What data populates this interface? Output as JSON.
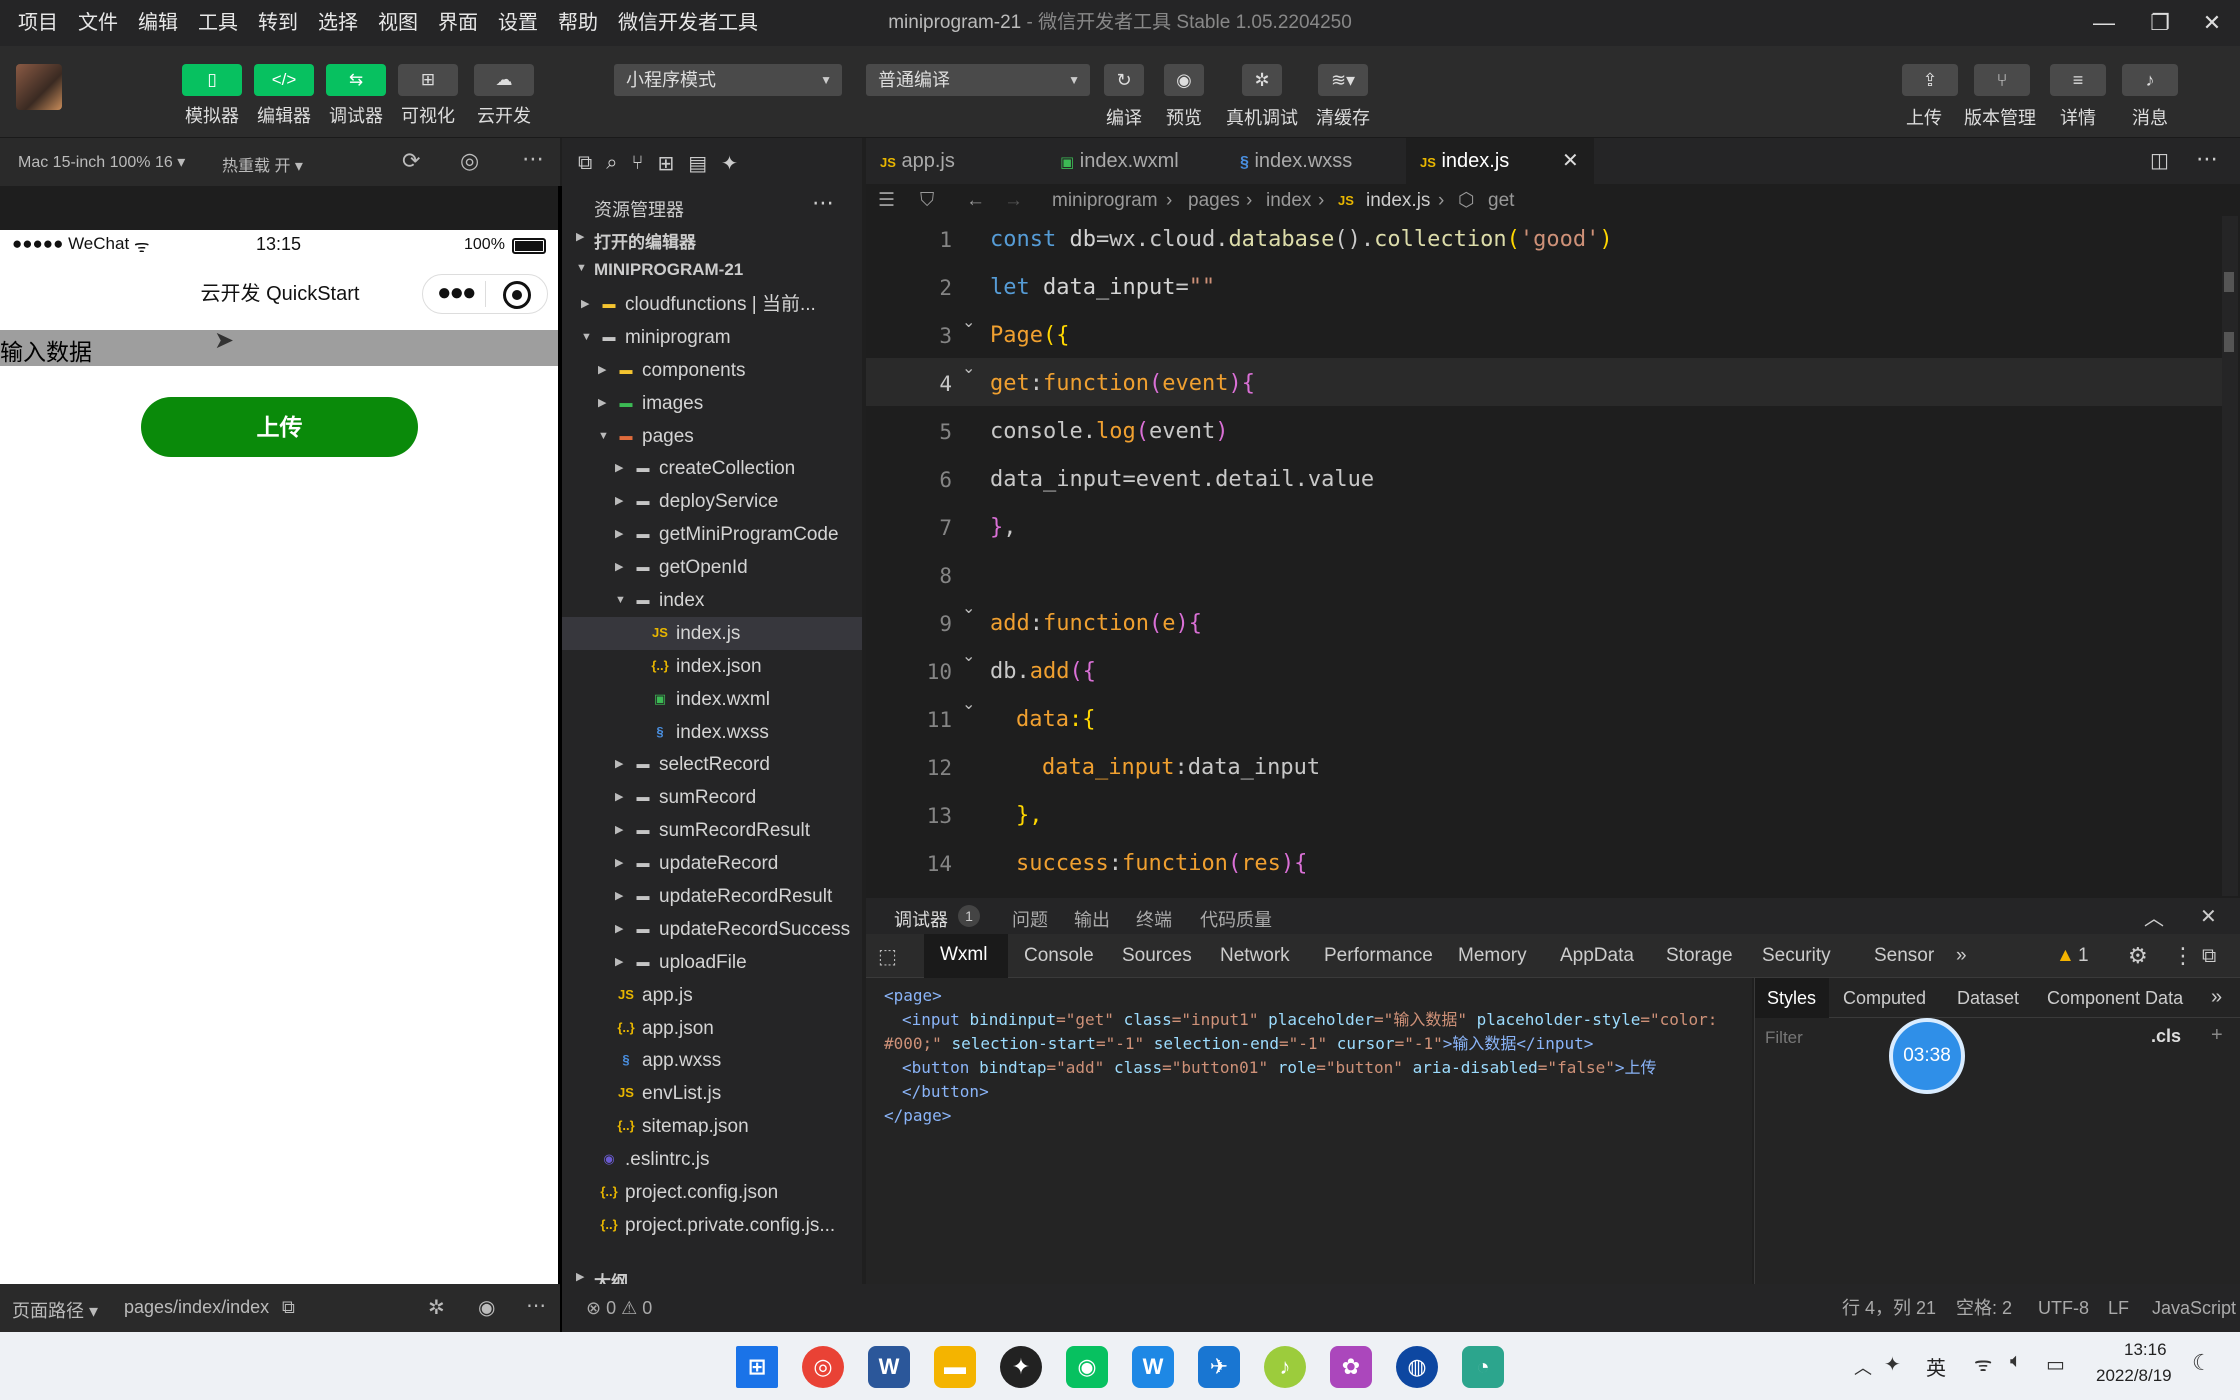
{
  "menu": [
    "项目",
    "文件",
    "编辑",
    "工具",
    "转到",
    "选择",
    "视图",
    "界面",
    "设置",
    "帮助",
    "微信开发者工具"
  ],
  "window": {
    "title": "miniprogram-21",
    "subtitle": " - 微信开发者工具 Stable 1.05.2204250"
  },
  "toolbar": {
    "buttons": [
      {
        "label": "模拟器"
      },
      {
        "label": "编辑器"
      },
      {
        "label": "调试器"
      },
      {
        "label": "可视化"
      },
      {
        "label": "云开发"
      }
    ],
    "mode_select": "小程序模式",
    "compile_select": "普通编译",
    "actions": [
      "编译",
      "预览",
      "真机调试",
      "清缓存"
    ],
    "right": [
      "上传",
      "版本管理",
      "详情",
      "消息"
    ]
  },
  "simulator": {
    "device": "Mac 15-inch 100% 16 ▾",
    "hotreload": "热重载 开 ▾",
    "status_carrier": "●●●●● WeChat",
    "status_time": "13:15",
    "status_battery": "100%",
    "nav_title": "云开发 QuickStart",
    "input_placeholder": "输入数据",
    "upload_button": "上传",
    "path_label": "页面路径 ▾",
    "path_value": "pages/index/index"
  },
  "explorer": {
    "title": "资源管理器",
    "open_editors": "打开的编辑器",
    "project": "MINIPROGRAM-21",
    "outline": "大纲",
    "items": [
      {
        "name": "cloudfunctions | 当前...",
        "type": "folder-cloud"
      },
      {
        "name": "miniprogram",
        "type": "folder-open"
      },
      {
        "name": "components",
        "type": "folder-comp"
      },
      {
        "name": "images",
        "type": "folder-img"
      },
      {
        "name": "pages",
        "type": "folder-pages"
      },
      {
        "name": "createCollection",
        "type": "folder"
      },
      {
        "name": "deployService",
        "type": "folder"
      },
      {
        "name": "getMiniProgramCode",
        "type": "folder"
      },
      {
        "name": "getOpenId",
        "type": "folder"
      },
      {
        "name": "index",
        "type": "folder-open"
      },
      {
        "name": "index.js",
        "type": "js"
      },
      {
        "name": "index.json",
        "type": "json"
      },
      {
        "name": "index.wxml",
        "type": "wxml"
      },
      {
        "name": "index.wxss",
        "type": "wxss"
      },
      {
        "name": "selectRecord",
        "type": "folder"
      },
      {
        "name": "sumRecord",
        "type": "folder"
      },
      {
        "name": "sumRecordResult",
        "type": "folder"
      },
      {
        "name": "updateRecord",
        "type": "folder"
      },
      {
        "name": "updateRecordResult",
        "type": "folder"
      },
      {
        "name": "updateRecordSuccess",
        "type": "folder"
      },
      {
        "name": "uploadFile",
        "type": "folder"
      },
      {
        "name": "app.js",
        "type": "js"
      },
      {
        "name": "app.json",
        "type": "json"
      },
      {
        "name": "app.wxss",
        "type": "wxss"
      },
      {
        "name": "envList.js",
        "type": "js"
      },
      {
        "name": "sitemap.json",
        "type": "json"
      },
      {
        "name": ".eslintrc.js",
        "type": "eslint"
      },
      {
        "name": "project.config.json",
        "type": "json"
      },
      {
        "name": "project.private.config.js...",
        "type": "json"
      }
    ]
  },
  "tabs": [
    {
      "name": "app.js",
      "icon": "JS"
    },
    {
      "name": "index.wxml",
      "icon": "W"
    },
    {
      "name": "index.wxss",
      "icon": "§"
    },
    {
      "name": "index.js",
      "icon": "JS",
      "active": true
    }
  ],
  "breadcrumb": [
    "miniprogram",
    "pages",
    "index",
    "index.js",
    "get"
  ],
  "code": [
    {
      "n": "1"
    },
    {
      "n": "2"
    },
    {
      "n": "3"
    },
    {
      "n": "4"
    },
    {
      "n": "5"
    },
    {
      "n": "6"
    },
    {
      "n": "7"
    },
    {
      "n": "8"
    },
    {
      "n": "9"
    },
    {
      "n": "10"
    },
    {
      "n": "11"
    },
    {
      "n": "12"
    },
    {
      "n": "13"
    },
    {
      "n": "14"
    }
  ],
  "code_text": {
    "l1a": "const ",
    "l1b": "db",
    "l1c": "=wx.cloud.",
    "l1d": "database",
    "l1e": "().",
    "l1f": "collection",
    "l1g": "(",
    "l1h": "'good'",
    "l1i": ")",
    "l2a": "let ",
    "l2b": "data_input",
    "l2c": "=",
    "l2d": "\"\"",
    "l3a": "Page",
    "l3b": "({",
    "l4a": "get",
    "l4b": ":",
    "l4c": "function",
    "l4d": "(",
    "l4e": "event",
    "l4f": "){",
    "l5a": "console",
    "l5b": ".",
    "l5c": "log",
    "l5d": "(",
    "l5e": "event",
    "l5f": ")",
    "l6a": "data_input",
    "l6b": "=event.detail.value",
    "l7a": "}",
    "l7b": ",",
    "l9a": "add",
    "l9b": ":",
    "l9c": "function",
    "l9d": "(",
    "l9e": "e",
    "l9f": "){",
    "l10a": "db",
    "l10b": ".",
    "l10c": "add",
    "l10d": "({",
    "l11a": "data",
    "l11b": ":{",
    "l12a": "data_input",
    "l12b": ":data_input",
    "l13a": "},",
    "l14a": "success",
    "l14b": ":",
    "l14c": "function",
    "l14d": "(",
    "l14e": "res",
    "l14f": "){"
  },
  "debug": {
    "tabs": [
      "调试器",
      "问题",
      "输出",
      "终端",
      "代码质量"
    ],
    "badge": "1",
    "devtools": [
      "Wxml",
      "Console",
      "Sources",
      "Network",
      "Performance",
      "Memory",
      "AppData",
      "Storage",
      "Security",
      "Sensor"
    ],
    "warn_count": "1",
    "wxml": {
      "l1": "<page>",
      "l2a": "<input ",
      "l2b": "bindinput",
      "l2c": "=\"get\" ",
      "l2d": "class",
      "l2e": "=\"input1\" ",
      "l2f": "placeholder",
      "l2g": "=\"输入数据\" ",
      "l2h": "placeholder-style",
      "l2i": "=\"color:",
      "l3a": "#000;\" ",
      "l3b": "selection-start",
      "l3c": "=\"-1\" ",
      "l3d": "selection-end",
      "l3e": "=\"-1\" ",
      "l3f": "cursor",
      "l3g": "=\"-1\"",
      "l3h": ">输入数据</input>",
      "l4a": "<button ",
      "l4b": "bindtap",
      "l4c": "=\"add\" ",
      "l4d": "class",
      "l4e": "=\"button01\" ",
      "l4f": "role",
      "l4g": "=\"button\" ",
      "l4h": "aria-disabled",
      "l4i": "=\"false\"",
      "l4j": ">上传",
      "l5": "</button>",
      "l6": "</page>"
    },
    "styles_tabs": [
      "Styles",
      "Computed",
      "Dataset",
      "Component Data"
    ],
    "filter_placeholder": "Filter",
    "cls": ".cls",
    "timer": "03:38"
  },
  "status": {
    "errors": "⊗ 0 ⚠ 0",
    "position": "行 4，列 21",
    "spaces": "空格: 2",
    "encoding": "UTF-8",
    "eol": "LF",
    "language": "JavaScript"
  },
  "taskbar": {
    "time": "13:16",
    "date": "2022/8/19",
    "ime": "英"
  }
}
